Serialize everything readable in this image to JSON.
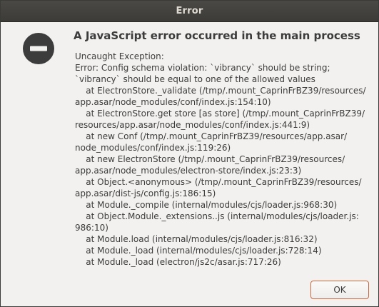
{
  "window": {
    "title": "Error"
  },
  "dialog": {
    "icon": "error-minus-circle-icon",
    "heading": "A JavaScript error occurred in the main process",
    "message_lines": [
      "Uncaught Exception:",
      "Error: Config schema violation: `vibrancy` should be string;",
      "`vibrancy` should be equal to one of the allowed values",
      "    at ElectronStore._validate (/tmp/.mount_CaprinFrBZ39/resources/",
      "app.asar/node_modules/conf/index.js:154:10)",
      "    at ElectronStore.get store [as store] (/tmp/.mount_CaprinFrBZ39/",
      "resources/app.asar/node_modules/conf/index.js:441:9)",
      "    at new Conf (/tmp/.mount_CaprinFrBZ39/resources/app.asar/",
      "node_modules/conf/index.js:119:26)",
      "    at new ElectronStore (/tmp/.mount_CaprinFrBZ39/resources/",
      "app.asar/node_modules/electron-store/index.js:23:3)",
      "    at Object.<anonymous> (/tmp/.mount_CaprinFrBZ39/resources/",
      "app.asar/dist-js/config.js:186:15)",
      "    at Module._compile (internal/modules/cjs/loader.js:968:30)",
      "    at Object.Module._extensions..js (internal/modules/cjs/loader.js:",
      "986:10)",
      "    at Module.load (internal/modules/cjs/loader.js:816:32)",
      "    at Module._load (internal/modules/cjs/loader.js:728:14)",
      "    at Module._load (electron/js2c/asar.js:717:26)"
    ],
    "ok_label": "OK"
  },
  "colors": {
    "titlebar": "#3c3b37",
    "icon": "#3c3c3c",
    "button_border": "#c9683f"
  }
}
